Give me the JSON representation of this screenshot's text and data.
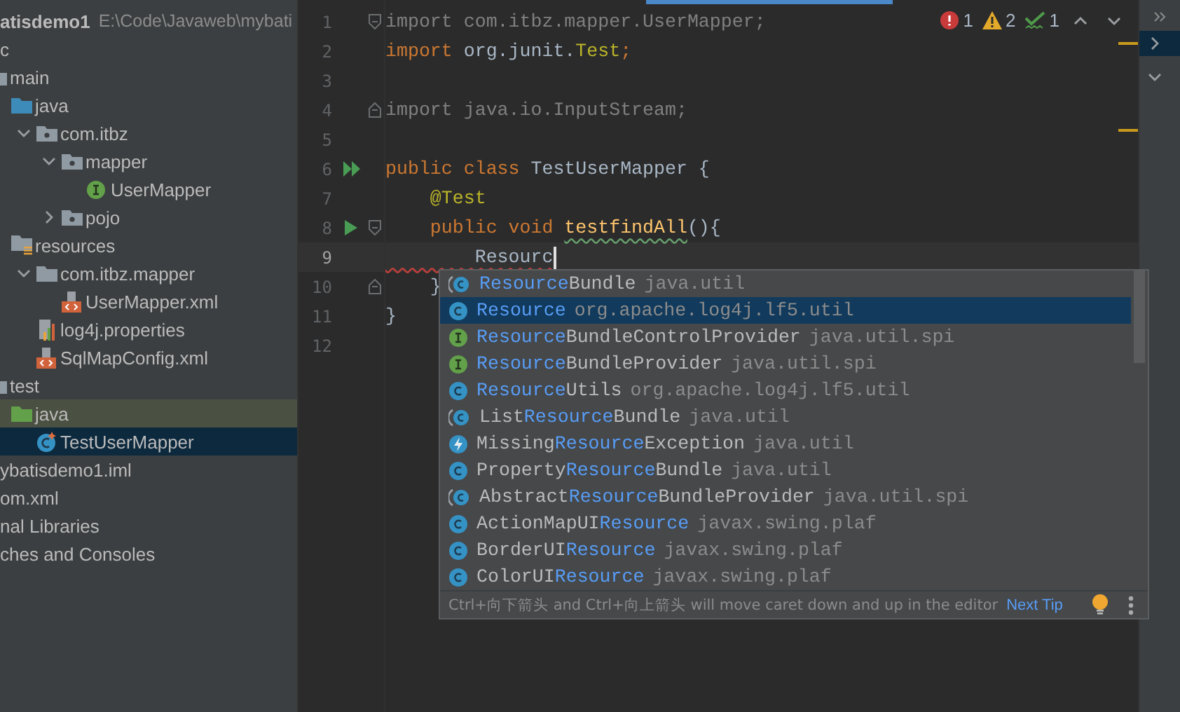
{
  "project_tree": {
    "header": {
      "name": "atisdemo1",
      "path": "E:\\Code\\Javaweb\\mybati"
    },
    "items": [
      {
        "label": "c",
        "selected": false,
        "highlighted": false,
        "children": [
          {
            "label": "main",
            "kind": "folder",
            "selected": false,
            "highlighted": false,
            "children": [
              {
                "label": "java",
                "kind": "source-folder",
                "selected": false,
                "highlighted": false,
                "children": [
                  {
                    "label": "com.itbz",
                    "kind": "package",
                    "expanded": true,
                    "selected": false,
                    "highlighted": false,
                    "children": [
                      {
                        "label": "mapper",
                        "kind": "package",
                        "expanded": true,
                        "selected": false,
                        "highlighted": false,
                        "children": [
                          {
                            "label": "UserMapper",
                            "kind": "interface",
                            "selected": false,
                            "highlighted": false
                          }
                        ]
                      },
                      {
                        "label": "pojo",
                        "kind": "package",
                        "expanded": false,
                        "selected": false,
                        "highlighted": false
                      }
                    ]
                  }
                ]
              },
              {
                "label": "resources",
                "kind": "resources-folder",
                "selected": false,
                "highlighted": false,
                "children": [
                  {
                    "label": "com.itbz.mapper",
                    "kind": "folder",
                    "expanded": true,
                    "selected": false,
                    "highlighted": false,
                    "children": [
                      {
                        "label": "UserMapper.xml",
                        "kind": "xml",
                        "selected": false,
                        "highlighted": false
                      }
                    ]
                  },
                  {
                    "label": "log4j.properties",
                    "kind": "properties",
                    "selected": false,
                    "highlighted": false
                  },
                  {
                    "label": "SqlMapConfig.xml",
                    "kind": "xml",
                    "selected": false,
                    "highlighted": false
                  }
                ]
              }
            ]
          },
          {
            "label": "test",
            "kind": "folder",
            "selected": false,
            "highlighted": false,
            "children": [
              {
                "label": "java",
                "kind": "test-folder",
                "selected": false,
                "highlighted": true,
                "children": [
                  {
                    "label": "TestUserMapper",
                    "kind": "test-class",
                    "selected": true,
                    "highlighted": false
                  }
                ]
              }
            ]
          }
        ]
      },
      {
        "label": "ybatisdemo1.iml",
        "selected": false,
        "highlighted": false
      },
      {
        "label": "om.xml",
        "selected": false,
        "highlighted": false
      },
      {
        "label": "nal Libraries",
        "selected": false,
        "highlighted": false
      },
      {
        "label": "ches and Consoles",
        "selected": false,
        "highlighted": false
      }
    ]
  },
  "editor": {
    "inspections": [
      {
        "kind": "error",
        "count": "1"
      },
      {
        "kind": "warning",
        "count": "2"
      },
      {
        "kind": "typo",
        "count": "1"
      }
    ],
    "lines": [
      {
        "number": "1",
        "current": false,
        "gutter_icons": [
          {
            "kind": "fold-start"
          }
        ],
        "tokens": [
          {
            "kind": "dim",
            "text": "import com.itbz.mapper.UserMapper;"
          }
        ]
      },
      {
        "number": "2",
        "current": false,
        "tokens": [
          {
            "kind": "keyword",
            "text": "import "
          },
          {
            "kind": "plain",
            "text": "org.junit."
          },
          {
            "kind": "annotation",
            "text": "Test"
          },
          {
            "kind": "keyword",
            "text": ";"
          }
        ]
      },
      {
        "number": "3",
        "current": false
      },
      {
        "number": "4",
        "current": false,
        "gutter_icons": [
          {
            "kind": "fold-end"
          }
        ],
        "tokens": [
          {
            "kind": "dim",
            "text": "import java.io.InputStream;"
          }
        ]
      },
      {
        "number": "5",
        "current": false
      },
      {
        "number": "6",
        "current": false,
        "gutter_icons": [
          {
            "kind": "run-all"
          }
        ],
        "tokens": [
          {
            "kind": "keyword",
            "text": "public class "
          },
          {
            "kind": "plain",
            "text": "TestUserMapper {"
          }
        ]
      },
      {
        "number": "7",
        "current": false,
        "tokens": [
          {
            "kind": "annotation",
            "text": "    @Test"
          }
        ]
      },
      {
        "number": "8",
        "current": false,
        "gutter_icons": [
          {
            "kind": "run"
          },
          {
            "kind": "fold-start"
          }
        ],
        "tokens": [
          {
            "kind": "keyword",
            "text": "    public void "
          },
          {
            "kind": "method-typo",
            "text": "testfindAll"
          },
          {
            "kind": "plain",
            "text": "(){"
          }
        ]
      },
      {
        "number": "9",
        "current": true,
        "tokens": [
          {
            "kind": "plain-error",
            "text": "        Resourc"
          },
          {
            "kind": "caret"
          }
        ]
      },
      {
        "number": "10",
        "current": false,
        "gutter_icons": [
          {
            "kind": "fold-end"
          }
        ],
        "tokens": [
          {
            "kind": "plain",
            "text": "    }"
          }
        ]
      },
      {
        "number": "11",
        "current": false,
        "tokens": [
          {
            "kind": "plain",
            "text": "}"
          }
        ]
      },
      {
        "number": "12",
        "current": false
      }
    ]
  },
  "completion": {
    "items": [
      {
        "kind": "abstract-class",
        "name": [
          {
            "kind": "match",
            "text": "Resource"
          },
          {
            "kind": "plain",
            "text": "Bundle"
          }
        ],
        "package": "java.util",
        "selected": false
      },
      {
        "kind": "class",
        "name": [
          {
            "kind": "match",
            "text": "Resource"
          }
        ],
        "package": "org.apache.log4j.lf5.util",
        "selected": true
      },
      {
        "kind": "interface",
        "name": [
          {
            "kind": "match",
            "text": "Resource"
          },
          {
            "kind": "plain",
            "text": "BundleControlProvider"
          }
        ],
        "package": "java.util.spi",
        "selected": false
      },
      {
        "kind": "interface",
        "name": [
          {
            "kind": "match",
            "text": "Resource"
          },
          {
            "kind": "plain",
            "text": "BundleProvider"
          }
        ],
        "package": "java.util.spi",
        "selected": false
      },
      {
        "kind": "class",
        "name": [
          {
            "kind": "match",
            "text": "Resource"
          },
          {
            "kind": "plain",
            "text": "Utils"
          }
        ],
        "package": "org.apache.log4j.lf5.util",
        "selected": false
      },
      {
        "kind": "abstract-class",
        "name": [
          {
            "kind": "plain",
            "text": "List"
          },
          {
            "kind": "match",
            "text": "Resource"
          },
          {
            "kind": "plain",
            "text": "Bundle"
          }
        ],
        "package": "java.util",
        "selected": false
      },
      {
        "kind": "exception",
        "name": [
          {
            "kind": "plain",
            "text": "Missing"
          },
          {
            "kind": "match",
            "text": "Resource"
          },
          {
            "kind": "plain",
            "text": "Exception"
          }
        ],
        "package": "java.util",
        "selected": false
      },
      {
        "kind": "class",
        "name": [
          {
            "kind": "plain",
            "text": "Property"
          },
          {
            "kind": "match",
            "text": "Resource"
          },
          {
            "kind": "plain",
            "text": "Bundle"
          }
        ],
        "package": "java.util",
        "selected": false
      },
      {
        "kind": "abstract-class",
        "name": [
          {
            "kind": "plain",
            "text": "Abstract"
          },
          {
            "kind": "match",
            "text": "Resource"
          },
          {
            "kind": "plain",
            "text": "BundleProvider"
          }
        ],
        "package": "java.util.spi",
        "selected": false
      },
      {
        "kind": "class",
        "name": [
          {
            "kind": "plain",
            "text": "ActionMapUI"
          },
          {
            "kind": "match",
            "text": "Resource"
          }
        ],
        "package": "javax.swing.plaf",
        "selected": false
      },
      {
        "kind": "class",
        "name": [
          {
            "kind": "plain",
            "text": "BorderUI"
          },
          {
            "kind": "match",
            "text": "Resource"
          }
        ],
        "package": "javax.swing.plaf",
        "selected": false
      },
      {
        "kind": "class",
        "name": [
          {
            "kind": "plain",
            "text": "ColorUI"
          },
          {
            "kind": "match",
            "text": "Resource"
          }
        ],
        "package": "javax.swing.plaf",
        "selected": false
      }
    ],
    "tip": "Ctrl+向下箭头 and Ctrl+向上箭头 will move caret down and up in the editor",
    "link": "Next Tip"
  }
}
